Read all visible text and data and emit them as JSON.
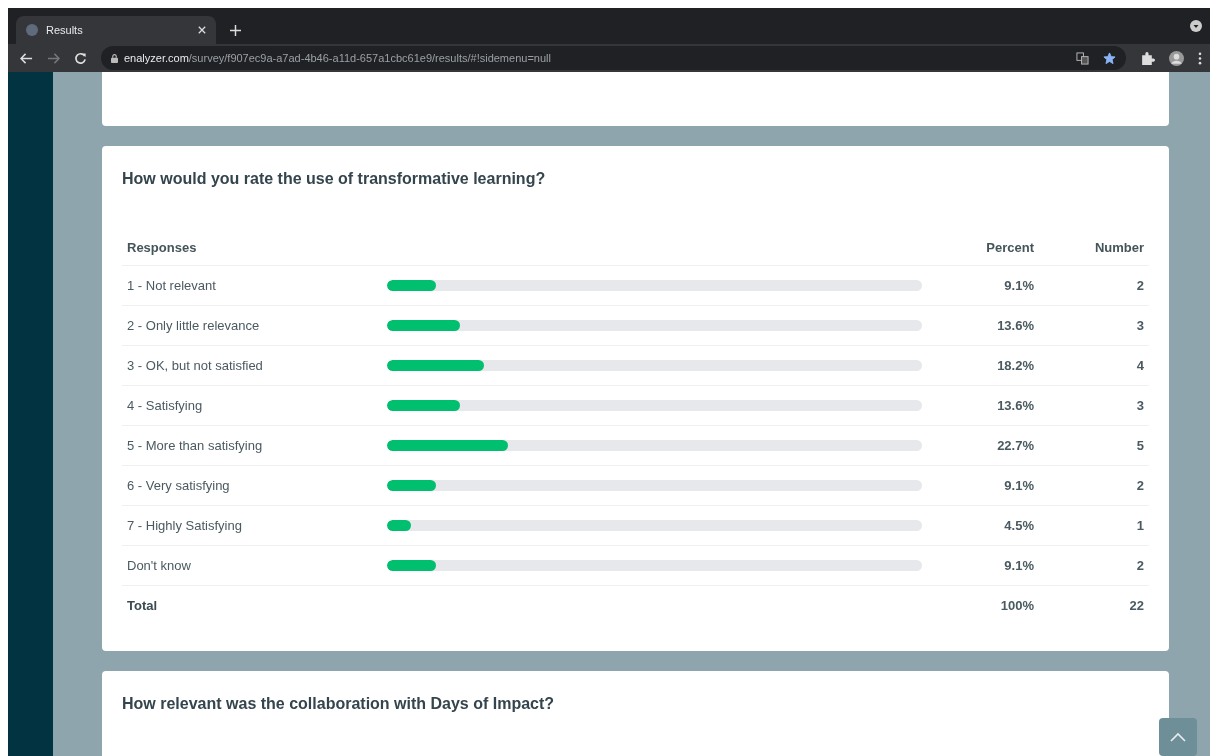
{
  "browser": {
    "tabs": [
      {
        "title": "Results",
        "selected": true
      }
    ],
    "url": {
      "domain": "enalyzer.com",
      "path": "/survey/f907ec9a-a7ad-4b46-a11d-657a1cbc61e9/results/#!sidemenu=null"
    },
    "bookmarked": true
  },
  "question": {
    "title": "How would you rate the use of transformative learning?",
    "columns": [
      "Responses",
      "Percent",
      "Number"
    ],
    "rows": [
      {
        "label": "1 - Not relevant",
        "level": 0.091,
        "percent": "9.1%",
        "number": "2"
      },
      {
        "label": "2 - Only little relevance",
        "level": 0.136,
        "percent": "13.6%",
        "number": "3"
      },
      {
        "label": "3 - OK, but not satisfied",
        "level": 0.182,
        "percent": "18.2%",
        "number": "4"
      },
      {
        "label": "4 - Satisfying",
        "level": 0.136,
        "percent": "13.6%",
        "number": "3"
      },
      {
        "label": "5 - More than satisfying",
        "level": 0.227,
        "percent": "22.7%",
        "number": "5"
      },
      {
        "label": "6 - Very satisfying",
        "level": 0.091,
        "percent": "9.1%",
        "number": "2"
      },
      {
        "label": "7 - Highly Satisfying",
        "level": 0.045,
        "percent": "4.5%",
        "number": "1"
      },
      {
        "label": "Don't know",
        "level": 0.091,
        "percent": "9.1%",
        "number": "2"
      }
    ],
    "total": {
      "label": "Total",
      "percent": "100%",
      "number": "22"
    }
  },
  "next_question": {
    "title": "How relevant was the collaboration with Days of Impact?"
  }
}
